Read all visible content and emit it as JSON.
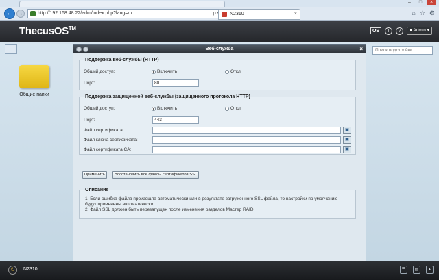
{
  "browser": {
    "address": "http://192.168.48.22/adm/index.php?lang=ru",
    "address_icons": "ρ ▾ ↻",
    "tab_title": "N2310",
    "tab_close": "×",
    "back_icon": "arrow-left-icon",
    "forward_icon": "arrow-right-icon",
    "win_min": "–",
    "win_max": "□",
    "win_close": "×",
    "tool_home": "⌂",
    "tool_star": "☆",
    "tool_gear": "⚙"
  },
  "app": {
    "logo": "ThecusOS",
    "logo_tm": "TM",
    "os_badge": "OS",
    "info_icon": "!",
    "help_icon": "?",
    "admin_label": "Admin"
  },
  "desktop": {
    "shared_folders_label": "Общие папки",
    "search_placeholder": "Поиск подстройки"
  },
  "dialog": {
    "title": "Веб-служба",
    "close_icon": "×",
    "http": {
      "legend": "Поддержка веб-службы (HTTP)",
      "access_label": "Общий доступ:",
      "enable_label": "Включить",
      "disable_label": "Откл.",
      "enabled": true,
      "port_label": "Порт:",
      "port_value": "80"
    },
    "https": {
      "legend": "Поддержка защищенной веб-службы (защищенного протокола HTTP)",
      "access_label": "Общий доступ:",
      "enable_label": "Включить",
      "disable_label": "Откл.",
      "enabled": true,
      "port_label": "Порт:",
      "port_value": "443",
      "cert_label": "Файл сертификата:",
      "cert_key_label": "Файл ключа сертификата:",
      "ca_cert_label": "Файл сертификата CA:"
    },
    "apply_button": "Применить",
    "restore_button": "Восстановить все файлы сертификатов SSL",
    "description": {
      "legend": "Описание",
      "line1": "1. Если ошибка файла произошла автоматически или в результате загруженного SSL файла, то настройки по умолчанию",
      "line1b": "будут применены автоматически.",
      "line2": "2. Файл SSL должен быть перезапущен после изменения разделов Мастер RAID."
    }
  },
  "bottom": {
    "device_name": "N2310"
  }
}
